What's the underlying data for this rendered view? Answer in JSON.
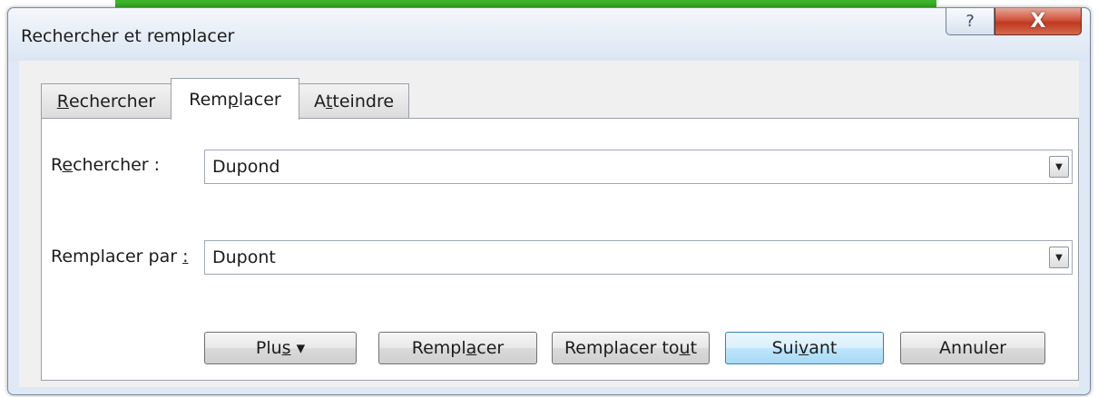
{
  "dialog": {
    "title": "Rechercher et remplacer",
    "help_symbol": "?",
    "close_symbol": "X"
  },
  "tabs": [
    {
      "label_pre": "",
      "label_key": "R",
      "label_post": "echercher",
      "selected": false
    },
    {
      "label_pre": "Rem",
      "label_key": "p",
      "label_post": "lacer",
      "selected": true
    },
    {
      "label_pre": "A",
      "label_key": "t",
      "label_post": "teindre",
      "selected": false
    }
  ],
  "find": {
    "label_pre": "R",
    "label_key": "e",
    "label_post": "chercher :",
    "value": "Dupond"
  },
  "replace": {
    "label_pre": "Remplacer par ",
    "label_key": ":",
    "label_post": "",
    "value": "Dupont"
  },
  "buttons": {
    "plus": {
      "pre": "Plu",
      "key": "s",
      "post": " ",
      "arrow": "▾"
    },
    "replace": {
      "pre": "Rempl",
      "key": "a",
      "post": "cer"
    },
    "replace_all": {
      "pre": "Remplacer to",
      "key": "u",
      "post": "t"
    },
    "next": {
      "pre": "Sui",
      "key": "v",
      "post": "ant"
    },
    "cancel": {
      "label": "Annuler"
    }
  },
  "colors": {
    "banner": "#2f9d20",
    "close_button": "#c0391f",
    "default_button_border": "#3c7fb1"
  }
}
